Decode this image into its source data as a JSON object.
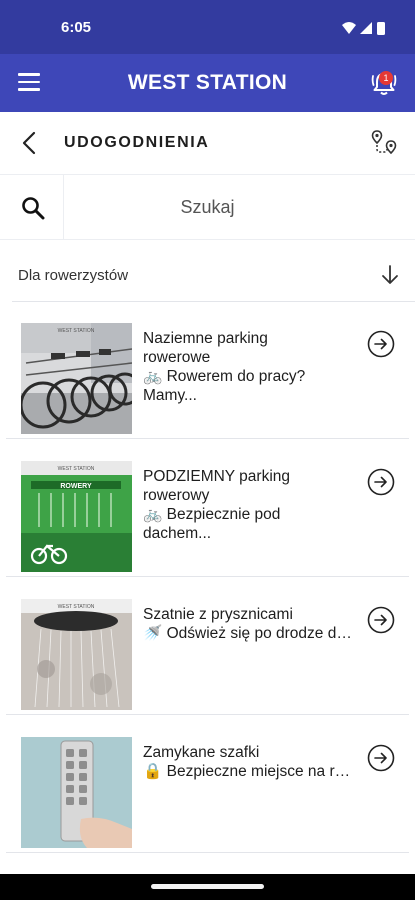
{
  "status_bar": {
    "time": "6:05",
    "icons": [
      "wifi-icon",
      "signal-icon",
      "battery-icon"
    ]
  },
  "app_bar": {
    "title": "WEST STATION",
    "notification_count": "1",
    "menu_icon": "menu-icon",
    "bell_icon": "bell-icon"
  },
  "page": {
    "title": "UDOGODNIENIA",
    "back_icon": "back-arrow-icon",
    "map_icon": "map-route-icon"
  },
  "search": {
    "placeholder": "Szukaj",
    "value": ""
  },
  "filter": {
    "label": "Dla rowerzystów",
    "sort_icon": "arrow-down-icon"
  },
  "items": [
    {
      "title": "Naziemne parking",
      "title2": "rowerowe",
      "subtitle": "🚲 Rowerem do pracy?",
      "subtitle2": "Mamy...",
      "thumb": "bike-rack-photo"
    },
    {
      "title": "PODZIEMNY parking",
      "title2": "rowerowy",
      "subtitle": "🚲 Bezpiecznie pod",
      "subtitle2": "dachem...",
      "thumb": "underground-bike-parking-photo",
      "thumb_sign": "ROWERY"
    },
    {
      "title": "Szatnie z prysznicami",
      "subtitle": "🚿 Odśwież się po drodze do pracy",
      "thumb": "shower-photo"
    },
    {
      "title": "Zamykane szafki",
      "subtitle": "🔒 Bezpieczne miejsce na rzeczy",
      "thumb": "locker-keypad-photo"
    }
  ],
  "thumb_logo": "WEST STATION",
  "colors": {
    "status_bar": "#333b9f",
    "app_bar": "#3e47b8",
    "badge": "#e53935",
    "text": "#1e1e1e",
    "divider": "#e3e5ea"
  }
}
